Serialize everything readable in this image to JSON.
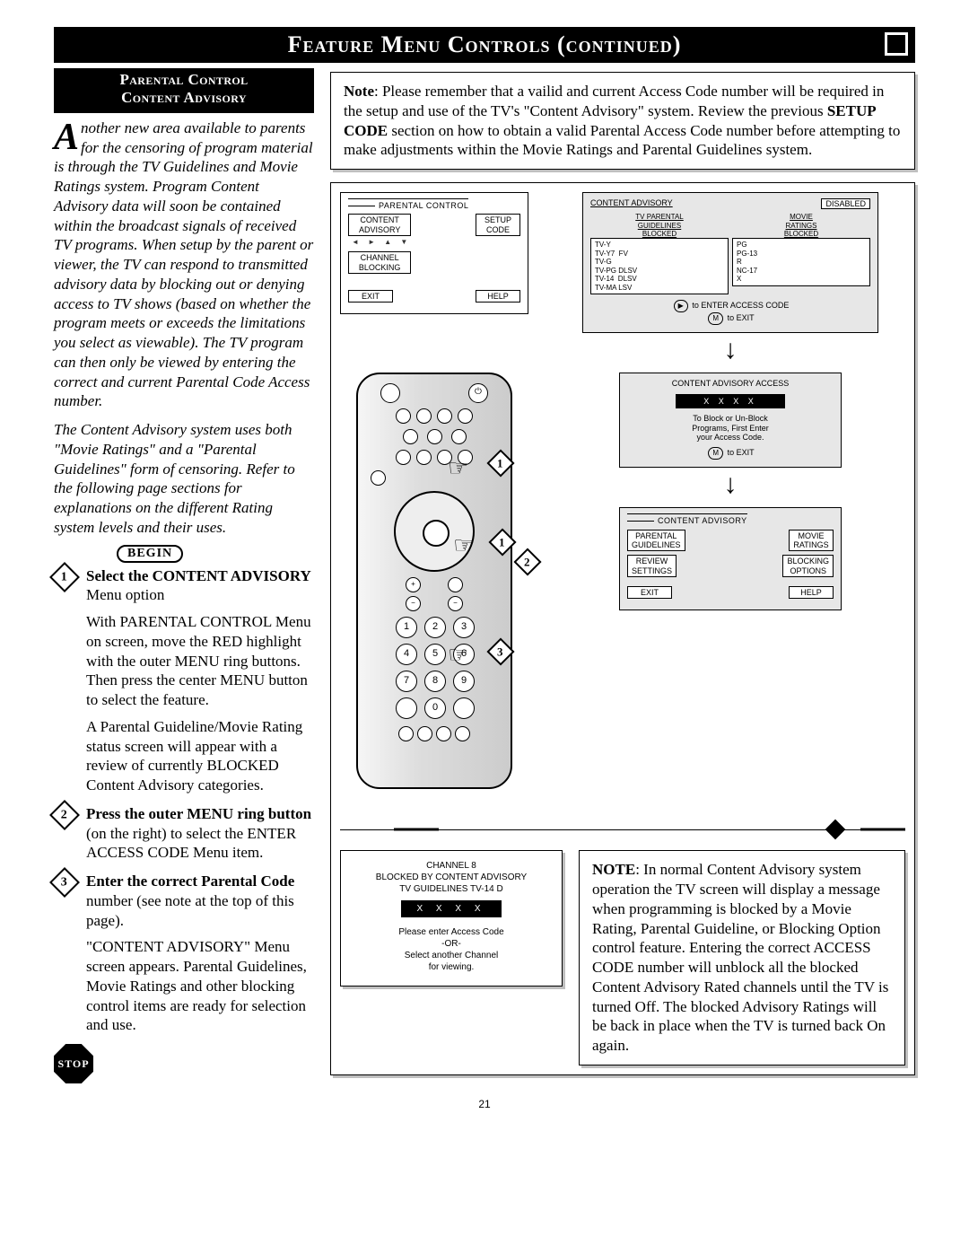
{
  "header": {
    "title": "Feature Menu Controls (continued)"
  },
  "left": {
    "heading_line1": "Parental Control",
    "heading_line2": "Content Advisory",
    "dropcap": "A",
    "intro": "nother new area available to parents for the censoring of program material is through the TV Guidelines and Movie Ratings system. Program Content Advisory data will soon be contained within the broadcast signals of received TV programs. When setup by the parent or viewer, the TV can respond to transmitted advisory data by blocking out or denying access to TV shows (based on whether the program meets or exceeds the limitations you select as viewable). The TV program can then only be viewed by entering the correct and current Parental Code Access number.",
    "intro2": "The Content Advisory system uses both \"Movie Ratings\" and a \"Parental Guidelines\" form of censoring. Refer to the following page sections for explanations on the different Rating system levels and their uses.",
    "begin": "BEGIN",
    "stop": "STOP",
    "steps": {
      "s1_bold": "Select the CONTENT ADVISORY",
      "s1_rest": " Menu option",
      "s1_p2": "With PARENTAL CONTROL Menu on screen, move the RED highlight with the outer MENU ring buttons. Then press the center MENU button to select the feature.",
      "s1_p3": "A Parental Guideline/Movie Rating status screen will appear with a review of currently BLOCKED Content Advisory categories.",
      "s2_bold": "Press the outer MENU ring button",
      "s2_rest": " (on the right) to select the ENTER ACCESS CODE Menu item.",
      "s3_bold": "Enter the correct Parental Code",
      "s3_rest": " number (see note at the top of this page).",
      "s3_p2": "\"CONTENT ADVISORY\" Menu screen appears. Parental Guidelines, Movie Ratings and other blocking control items are ready for selection and use."
    }
  },
  "right": {
    "note_label": "Note",
    "note_text": ": Please remember that a vailid and current Access Code number will be required in the setup and use of the TV's \"Content Advisory\" system. Review the previous ",
    "note_bold": "SETUP CODE",
    "note_text2": " section on how to obtain a valid Parental Access Code number before attempting to make adjustments within the Movie Ratings and Parental Guidelines system.",
    "menu1": {
      "title": "PARENTAL CONTROL",
      "content_advisory": "CONTENT\nADVISORY",
      "setup_code": "SETUP\nCODE",
      "channel_blocking": "CHANNEL\nBLOCKING",
      "exit": "EXIT",
      "help": "HELP"
    },
    "menu2": {
      "title_row": "CONTENT ADVISORY",
      "disabled": "DISABLED",
      "tv_col_title": "TV PARENTAL\nGUIDELINES\nBLOCKED",
      "movie_col_title": "MOVIE\nRATINGS\nBLOCKED",
      "tv_list": "TV-Y\nTV-Y7  FV\nTV-G\nTV-PG DLSV\nTV-14  DLSV\nTV-MA LSV",
      "movie_list": "PG\nPG-13\nR\nNC-17\nX",
      "hint1": "to ENTER ACCESS CODE",
      "hint2": "to EXIT",
      "m_key": "M",
      "play": "▶"
    },
    "menu3": {
      "title": "CONTENT ADVISORY ACCESS",
      "code": "X   X   X   X",
      "hint1": "To Block or Un-Block\nPrograms, First Enter\nyour Access Code.",
      "hint2": "to EXIT",
      "m_key": "M"
    },
    "menu4": {
      "title": "CONTENT ADVISORY",
      "parental_guidelines": "PARENTAL\nGUIDELINES",
      "movie_ratings": "MOVIE\nRATINGS",
      "review_settings": "REVIEW\nSETTINGS",
      "blocking_options": "BLOCKING\nOPTIONS",
      "exit": "EXIT",
      "help": "HELP"
    },
    "blocked": {
      "line1": "CHANNEL 8",
      "line2": "BLOCKED BY CONTENT ADVISORY",
      "line3": "TV GUIDELINES TV-14  D",
      "code": "X   X   X   X",
      "line4": "Please enter Access Code\n-OR-\nSelect another Channel\nfor viewing."
    },
    "bottom_note_label": "NOTE",
    "bottom_note": ": In normal Content Advisory system operation the TV screen will display a message when programming is blocked by a Movie Rating, Parental Guideline, or Blocking Option control feature. Entering the correct ACCESS CODE number will unblock all the blocked Content Advisory Rated channels until the TV is turned Off. The blocked Advisory Ratings will be back in place when the TV is turned back On again."
  },
  "page_number": "21"
}
